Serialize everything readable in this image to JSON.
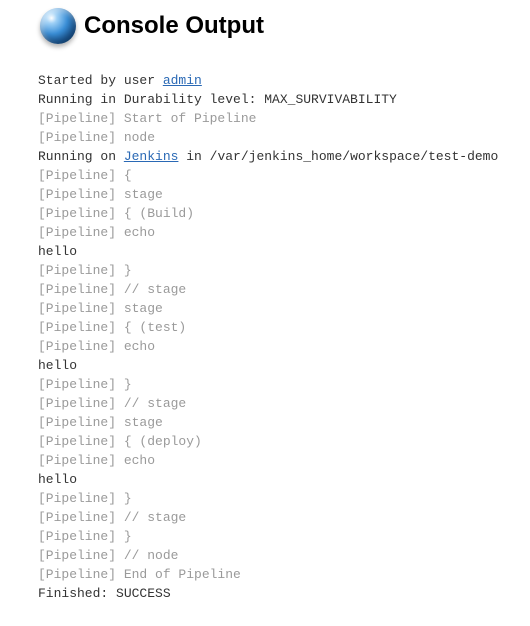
{
  "header": {
    "title": "Console Output"
  },
  "console": {
    "lines": [
      {
        "segments": [
          {
            "text": "Started by user ",
            "cls": "dark"
          },
          {
            "text": "admin",
            "cls": "dark",
            "link": true
          }
        ]
      },
      {
        "segments": [
          {
            "text": "Running in Durability level: MAX_SURVIVABILITY",
            "cls": "dark"
          }
        ]
      },
      {
        "segments": [
          {
            "text": "[Pipeline] Start of Pipeline",
            "cls": "dim"
          }
        ]
      },
      {
        "segments": [
          {
            "text": "[Pipeline] node",
            "cls": "dim"
          }
        ]
      },
      {
        "segments": [
          {
            "text": "Running on ",
            "cls": "dark"
          },
          {
            "text": "Jenkins",
            "cls": "dark",
            "link": true
          },
          {
            "text": " in /var/jenkins_home/workspace/test-demo",
            "cls": "dark"
          }
        ]
      },
      {
        "segments": [
          {
            "text": "[Pipeline] {",
            "cls": "dim"
          }
        ]
      },
      {
        "segments": [
          {
            "text": "[Pipeline] stage",
            "cls": "dim"
          }
        ]
      },
      {
        "segments": [
          {
            "text": "[Pipeline] { (Build)",
            "cls": "dim"
          }
        ]
      },
      {
        "segments": [
          {
            "text": "[Pipeline] echo",
            "cls": "dim"
          }
        ]
      },
      {
        "segments": [
          {
            "text": "hello",
            "cls": "dark"
          }
        ]
      },
      {
        "segments": [
          {
            "text": "[Pipeline] }",
            "cls": "dim"
          }
        ]
      },
      {
        "segments": [
          {
            "text": "[Pipeline] // stage",
            "cls": "dim"
          }
        ]
      },
      {
        "segments": [
          {
            "text": "[Pipeline] stage",
            "cls": "dim"
          }
        ]
      },
      {
        "segments": [
          {
            "text": "[Pipeline] { (test)",
            "cls": "dim"
          }
        ]
      },
      {
        "segments": [
          {
            "text": "[Pipeline] echo",
            "cls": "dim"
          }
        ]
      },
      {
        "segments": [
          {
            "text": "hello",
            "cls": "dark"
          }
        ]
      },
      {
        "segments": [
          {
            "text": "[Pipeline] }",
            "cls": "dim"
          }
        ]
      },
      {
        "segments": [
          {
            "text": "[Pipeline] // stage",
            "cls": "dim"
          }
        ]
      },
      {
        "segments": [
          {
            "text": "[Pipeline] stage",
            "cls": "dim"
          }
        ]
      },
      {
        "segments": [
          {
            "text": "[Pipeline] { (deploy)",
            "cls": "dim"
          }
        ]
      },
      {
        "segments": [
          {
            "text": "[Pipeline] echo",
            "cls": "dim"
          }
        ]
      },
      {
        "segments": [
          {
            "text": "hello",
            "cls": "dark"
          }
        ]
      },
      {
        "segments": [
          {
            "text": "[Pipeline] }",
            "cls": "dim"
          }
        ]
      },
      {
        "segments": [
          {
            "text": "[Pipeline] // stage",
            "cls": "dim"
          }
        ]
      },
      {
        "segments": [
          {
            "text": "[Pipeline] }",
            "cls": "dim"
          }
        ]
      },
      {
        "segments": [
          {
            "text": "[Pipeline] // node",
            "cls": "dim"
          }
        ]
      },
      {
        "segments": [
          {
            "text": "[Pipeline] End of Pipeline",
            "cls": "dim"
          }
        ]
      },
      {
        "segments": [
          {
            "text": "Finished: SUCCESS",
            "cls": "dark"
          }
        ]
      }
    ]
  }
}
